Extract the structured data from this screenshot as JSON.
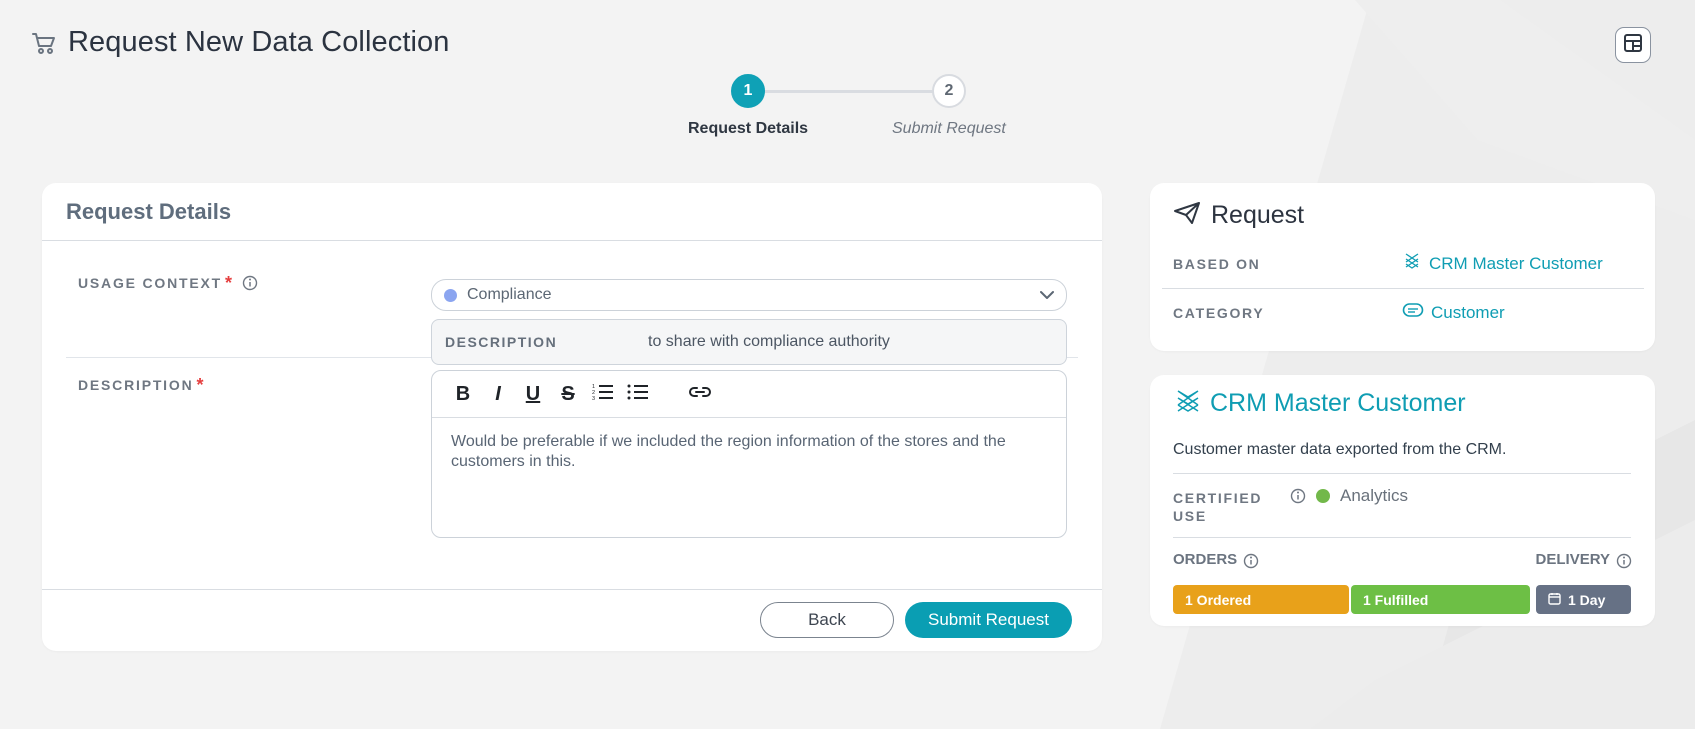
{
  "page": {
    "title": "Request New Data Collection"
  },
  "stepper": {
    "steps": [
      {
        "number": "1",
        "label": "Request Details"
      },
      {
        "number": "2",
        "label": "Submit Request"
      }
    ]
  },
  "request_details": {
    "section_title": "Request Details",
    "usage_context": {
      "label": "USAGE CONTEXT",
      "selected_value": "Compliance",
      "description_label": "DESCRIPTION",
      "description_value": "to share with compliance authority"
    },
    "description": {
      "label": "DESCRIPTION",
      "editor_text": "Would be preferable if we included the region information of the stores and the customers in this."
    },
    "actions": {
      "back_label": "Back",
      "submit_label": "Submit Request"
    }
  },
  "request_card": {
    "title": "Request",
    "based_on_label": "BASED ON",
    "based_on_value": "CRM Master Customer",
    "category_label": "CATEGORY",
    "category_value": "Customer"
  },
  "product_card": {
    "title": "CRM Master Customer",
    "description": "Customer master data exported from the CRM.",
    "certified_use_label": "CERTIFIED USE",
    "certified_use_value": "Analytics",
    "orders_label": "ORDERS",
    "delivery_label": "DELIVERY",
    "ordered_badge": "1 Ordered",
    "fulfilled_badge": "1 Fulfilled",
    "delivery_badge": "1 Day"
  },
  "colors": {
    "primary": "#0fa1b6",
    "orange": "#e8a11a",
    "green": "#6dbf45",
    "slate": "#667185"
  },
  "icons": {
    "header": "shopping-cart-icon",
    "layout": "layout-grid-icon",
    "request": "paper-plane-icon",
    "product": "crm-product-icon",
    "category": "tag-icon",
    "info": "info-icon",
    "chevron": "chevron-down-icon"
  }
}
